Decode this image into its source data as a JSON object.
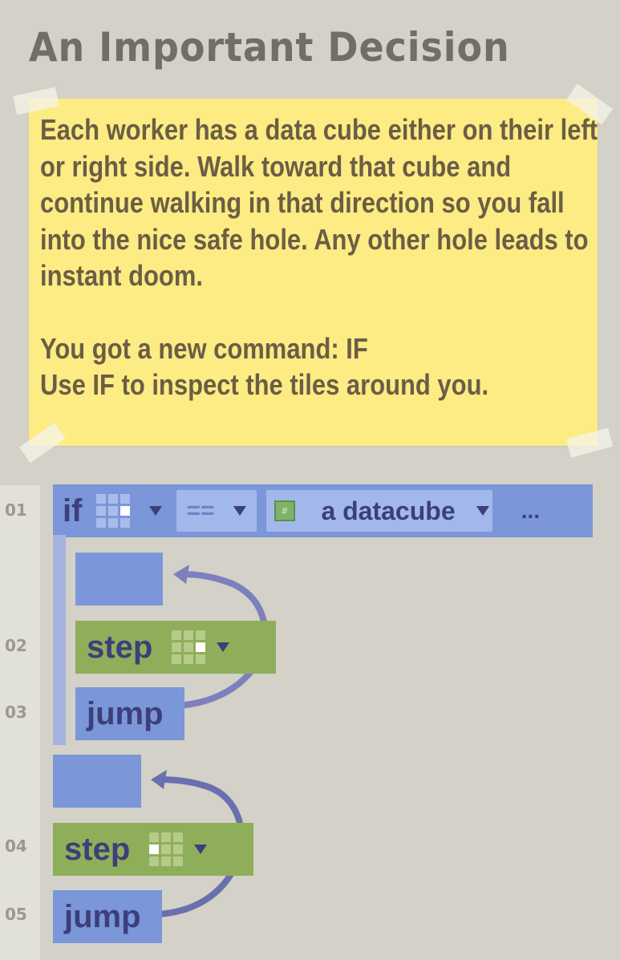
{
  "title": "An Important Decision",
  "note": {
    "paragraphs": [
      "Each worker has a data cube either on their left or right side. Walk toward that cube and continue walking in that direction so you fall into the nice safe hole. Any other hole leads to instant doom.",
      "You got a new command: IF",
      "Use IF to inspect the tiles around you."
    ]
  },
  "lines": [
    "01",
    "02",
    "03",
    "04",
    "05"
  ],
  "if_block": {
    "keyword": "if",
    "direction_grid_icon": "grid-center-right",
    "operator": "==",
    "value_icon": "datacube-icon",
    "value_label": "a datacube",
    "more": "..."
  },
  "commands": {
    "step1": {
      "label": "step",
      "direction": "right"
    },
    "jump1": {
      "label": "jump"
    },
    "step2": {
      "label": "step",
      "direction": "left"
    },
    "jump2": {
      "label": "jump"
    }
  },
  "colors": {
    "background": "#d3d1c8",
    "note": "#fdeb84",
    "block_blue": "#7b96d9",
    "block_green": "#8fae5a",
    "text_dark": "#3c3f7a"
  }
}
